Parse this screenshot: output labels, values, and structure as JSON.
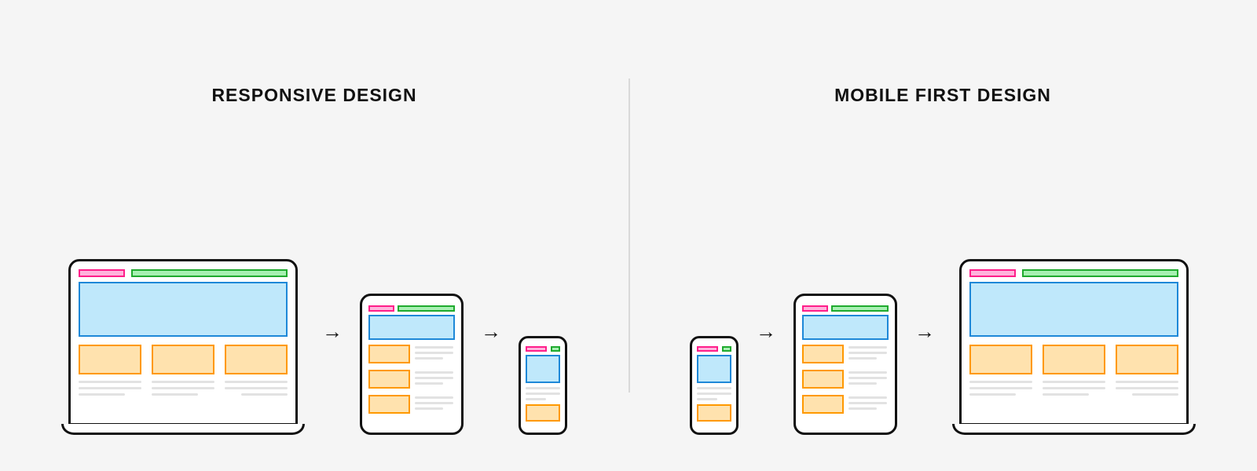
{
  "left": {
    "title": "RESPONSIVE DESIGN",
    "sequence": [
      "laptop",
      "tablet",
      "phone"
    ]
  },
  "right": {
    "title": "MOBILE FIRST DESIGN",
    "sequence": [
      "phone",
      "tablet",
      "laptop"
    ]
  },
  "arrow_glyph": "→",
  "colors": {
    "pink": {
      "border": "#ff1e8a",
      "fill": "#ffb3dc"
    },
    "green": {
      "border": "#1faa2e",
      "fill": "#a7f0b2"
    },
    "blue": {
      "border": "#1e88d8",
      "fill": "#bfe8fb"
    },
    "orange": {
      "border": "#ff9900",
      "fill": "#ffe2ae"
    },
    "line": "#e2e2e2",
    "device_outline": "#111111",
    "background": "#f5f5f5"
  }
}
